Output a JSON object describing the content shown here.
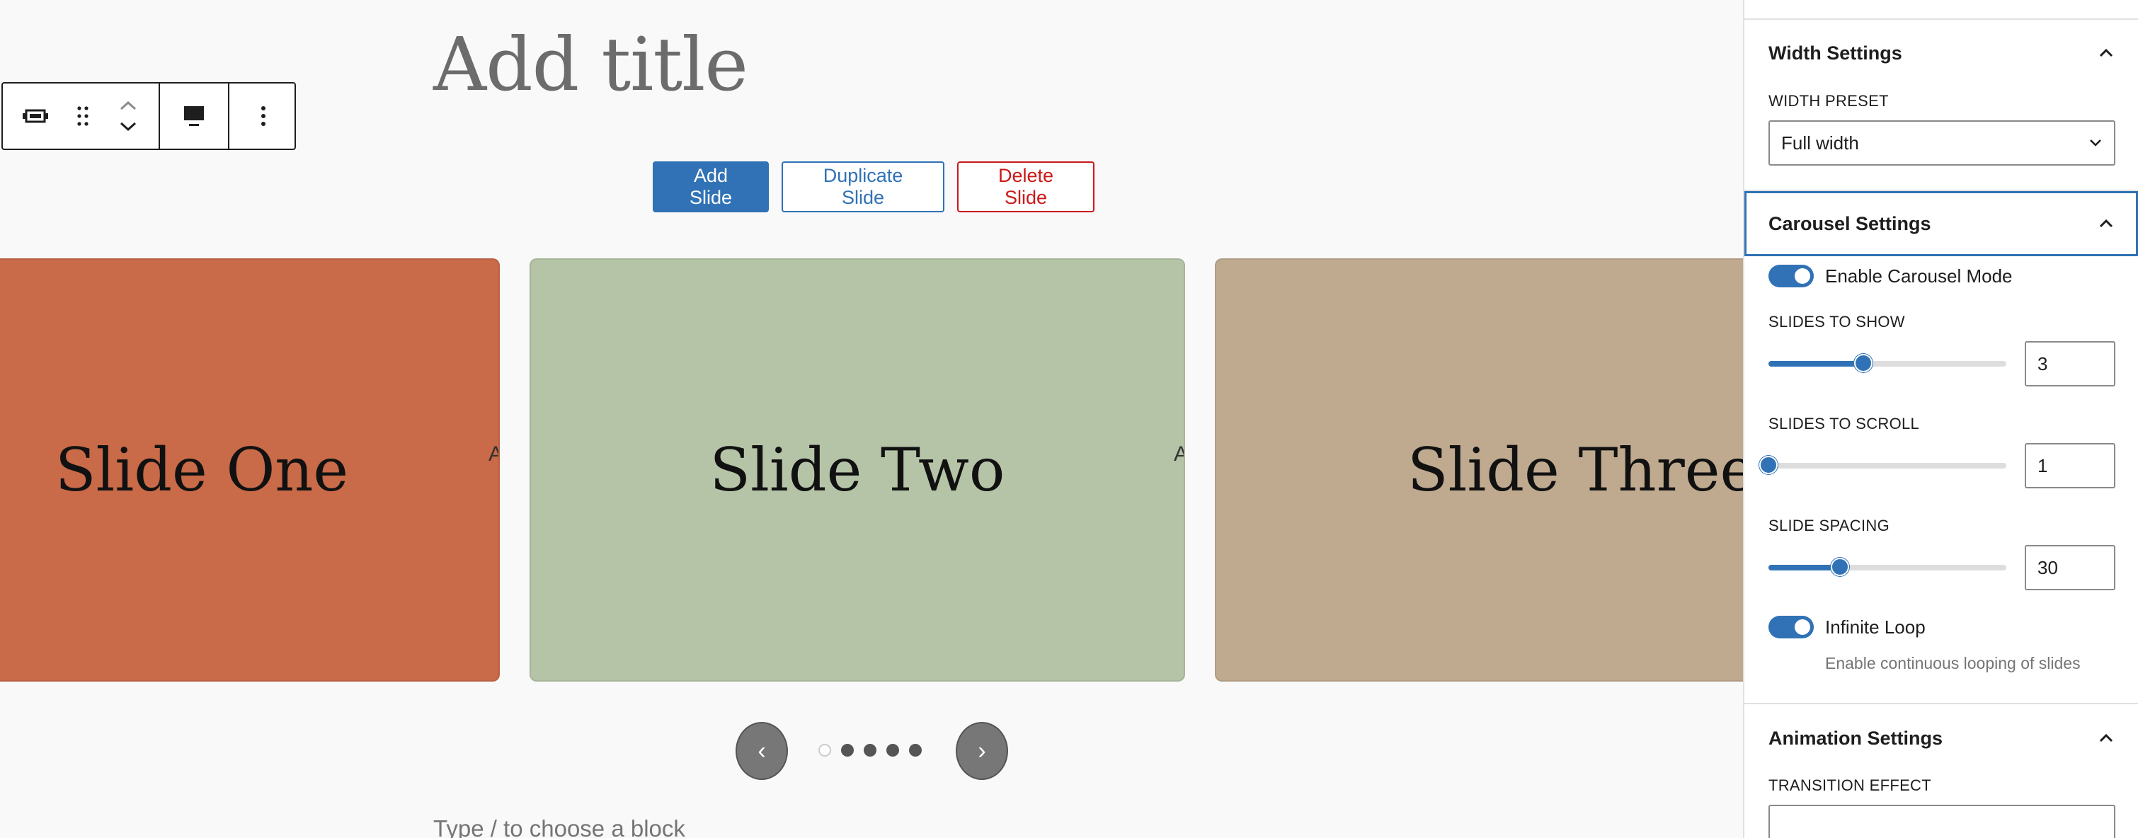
{
  "editor": {
    "post_title_placeholder": "Add title",
    "appender_placeholder": "Type / to choose a block"
  },
  "block_toolbar": {
    "items": [
      "block-type-icon",
      "drag-handle-icon",
      "move-up-icon",
      "move-down-icon",
      "align-icon",
      "more-options-icon"
    ]
  },
  "slide_actions": {
    "add": "Add Slide",
    "duplicate": "Duplicate Slide",
    "delete": "Delete Slide"
  },
  "slides": [
    {
      "title": "Slide One",
      "peek_text": "A",
      "color": "#c96a48"
    },
    {
      "title": "Slide Two",
      "peek_text": "A",
      "color": "#b5c4a7"
    },
    {
      "title": "Slide Three",
      "color": "#bfaa90"
    }
  ],
  "carousel_nav": {
    "prev_glyph": "‹",
    "next_glyph": "›",
    "dot_count": 5,
    "active_dot": 0
  },
  "sidebar": {
    "width_panel": {
      "title": "Width Settings",
      "width_preset_label": "Width preset",
      "width_preset_value": "Full width"
    },
    "carousel_panel": {
      "title": "Carousel Settings",
      "enable_carousel_label": "Enable Carousel Mode",
      "enable_carousel_on": true,
      "slides_to_show_label": "Slides to show",
      "slides_to_show_value": "3",
      "slides_to_show_fraction": 0.4,
      "slides_to_scroll_label": "Slides to scroll",
      "slides_to_scroll_value": "1",
      "slides_to_scroll_fraction": 0.0,
      "slide_spacing_label": "Slide spacing",
      "slide_spacing_value": "30",
      "slide_spacing_fraction": 0.3,
      "infinite_loop_label": "Infinite Loop",
      "infinite_loop_on": true,
      "infinite_loop_help": "Enable continuous looping of slides"
    },
    "animation_panel": {
      "title": "Animation Settings",
      "transition_effect_label": "Transition effect"
    }
  },
  "colors": {
    "accent": "#3072b5",
    "danger": "#cc1818"
  }
}
